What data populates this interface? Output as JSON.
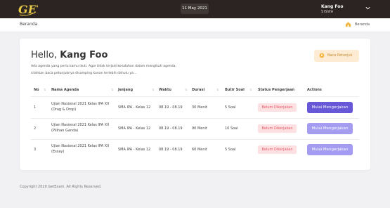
{
  "topbar": {
    "logo_text": "GET",
    "date": "11 May 2021",
    "user_name": "Kang Foo",
    "user_role": "SISWA"
  },
  "breadcrumb": {
    "current": "Beranda",
    "home_label": "Beranda"
  },
  "greeting": {
    "prefix": "Hello,",
    "name": "Kang Foo"
  },
  "description": "Ada agenda yang perlu kamu ikuti. Agar tidak terjadi kesalahan dalam mengikuti agenda, silahkan baca petunjuknya disamping kanan terlebih dahulu ya...",
  "guide_button": "Baca Petunjuk",
  "table": {
    "headers": [
      "No",
      "Nama Agenda",
      "Jenjang",
      "Waktu",
      "Durasi",
      "Butir Soal",
      "Status Pengerjaan",
      "Actions"
    ],
    "rows": [
      {
        "no": "1",
        "name_line1": "Ujian Nasional 2021 Kelas IPA XII",
        "name_line2": "(Drag & Drop)",
        "level": "SMA IPA - Kelas 12",
        "time": "08.19 - 08.19",
        "duration": "30 Menit",
        "items": "5 Soal",
        "status": "Belum Dikerjakan",
        "action": "Mulai Mengerjakan"
      },
      {
        "no": "2",
        "name_line1": "Ujian Nasional 2021 Kelas IPA XII",
        "name_line2": "(Pilihan Ganda)",
        "level": "SMA IPA - Kelas 12",
        "time": "08.19 - 08.19",
        "duration": "90 Menit",
        "items": "10 Soal",
        "status": "Belum Dikerjakan",
        "action": "Mulai Mengerjakan"
      },
      {
        "no": "3",
        "name_line1": "Ujian Nasional 2021 Kelas IPA XII",
        "name_line2": "(Essay)",
        "level": "SMA IPA - Kelas 12",
        "time": "08.19 - 08.19",
        "duration": "60 Menit",
        "items": "5 Soal",
        "status": "Belum Dikerjakan",
        "action": "Mulai Mengerjakan"
      }
    ]
  },
  "footer": "Copyright 2020 GetExam. All Rights Reserved.",
  "colors": {
    "topbar_bg": "#2b2422",
    "primary_action": "#6658d6",
    "muted_action": "#a49cf0",
    "badge_bg": "#fde0e2",
    "badge_text": "#e45a66",
    "guide_bg": "#fdecd3",
    "logo": "#e8c948"
  },
  "icons": [
    "logo-mark",
    "chevron-down-icon",
    "home-icon",
    "lightbulb-icon",
    "sort-icon"
  ]
}
